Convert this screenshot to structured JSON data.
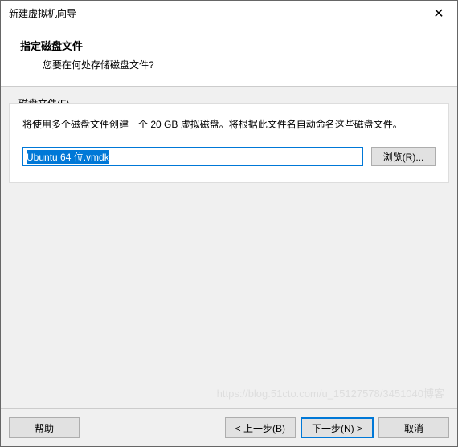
{
  "window": {
    "title": "新建虚拟机向导"
  },
  "header": {
    "title": "指定磁盘文件",
    "subtitle": "您要在何处存储磁盘文件?"
  },
  "group": {
    "legend": "磁盘文件(F)",
    "description": "将使用多个磁盘文件创建一个 20 GB 虚拟磁盘。将根据此文件名自动命名这些磁盘文件。",
    "filename": "Ubuntu 64 位.vmdk",
    "browse_label": "浏览(R)..."
  },
  "footer": {
    "help": "帮助",
    "back": "< 上一步(B)",
    "next": "下一步(N) >",
    "cancel": "取消"
  },
  "watermark": "https://blog.51cto.com/u_15127578/3451040博客"
}
